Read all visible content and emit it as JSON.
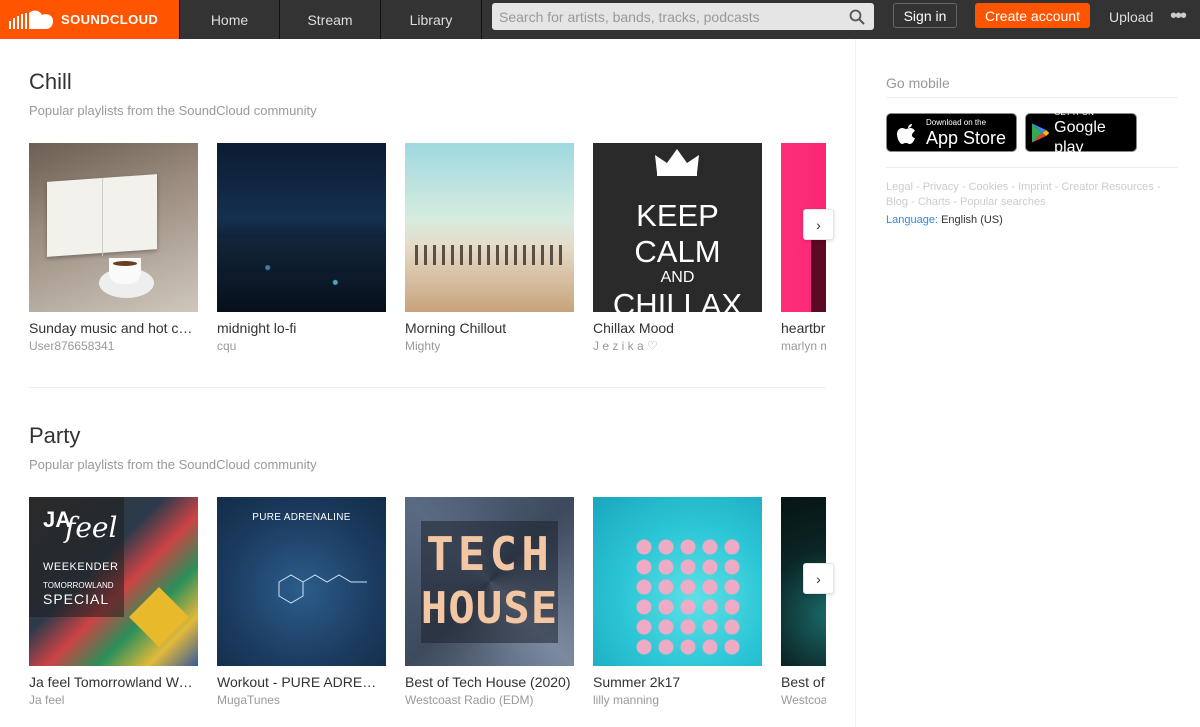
{
  "brand": {
    "name": "SOUNDCLOUD",
    "accent": "#ff5500"
  },
  "nav": {
    "items": [
      "Home",
      "Stream",
      "Library"
    ]
  },
  "search": {
    "placeholder": "Search for artists, bands, tracks, podcasts",
    "value": ""
  },
  "header": {
    "signin_label": "Sign in",
    "create_label": "Create account",
    "upload_label": "Upload",
    "more_label": "•••"
  },
  "sections": [
    {
      "title": "Chill",
      "subtitle": "Popular playlists from the SoundCloud community",
      "cards": [
        {
          "title": "Sunday music and hot coffee",
          "user": "User876658341",
          "art": "book-coffee"
        },
        {
          "title": "midnight lo-fi",
          "user": "cqu",
          "art": "night-city"
        },
        {
          "title": "Morning Chillout",
          "user": "Mighty",
          "art": "beach"
        },
        {
          "title": "Chillax Mood",
          "user": "J e z i k a ♡",
          "art": "keep-calm",
          "art_text": [
            "KEEP",
            "CALM",
            "AND",
            "CHILLAX"
          ]
        },
        {
          "title": "heartbreak",
          "user": "marlyn m",
          "art": "pink"
        }
      ]
    },
    {
      "title": "Party",
      "subtitle": "Popular playlists from the SoundCloud community",
      "cards": [
        {
          "title": "Ja feel Tomorrowland Weekender",
          "user": "Ja feel",
          "art": "tomorrowland",
          "art_text": [
            "JA",
            "feel",
            "WEEKENDER",
            "TOMORROWLAND",
            "SPECIAL"
          ]
        },
        {
          "title": "Workout - PURE ADRENALINE",
          "user": "MugaTunes",
          "art": "adrenaline",
          "art_text": [
            "PURE ADRENALINE"
          ]
        },
        {
          "title": "Best of Tech House (2020)",
          "user": "Westcoast Radio (EDM)",
          "art": "tech-house",
          "art_text": [
            "TECH",
            "HOUSE"
          ]
        },
        {
          "title": "Summer 2k17",
          "user": "lilly manning",
          "art": "flamingos"
        },
        {
          "title": "Best of",
          "user": "Westcoast",
          "art": "dark"
        }
      ]
    }
  ],
  "sidebar": {
    "go_mobile": "Go mobile",
    "appstore": {
      "small": "Download on the",
      "big": "App Store"
    },
    "googleplay": {
      "small": "GET IT ON",
      "big": "Google play"
    },
    "footer_links": [
      "Legal",
      "Privacy",
      "Cookies",
      "Imprint",
      "Creator Resources",
      "Blog",
      "Charts",
      "Popular searches"
    ],
    "language_label": "Language:",
    "language_value": "English (US)"
  }
}
